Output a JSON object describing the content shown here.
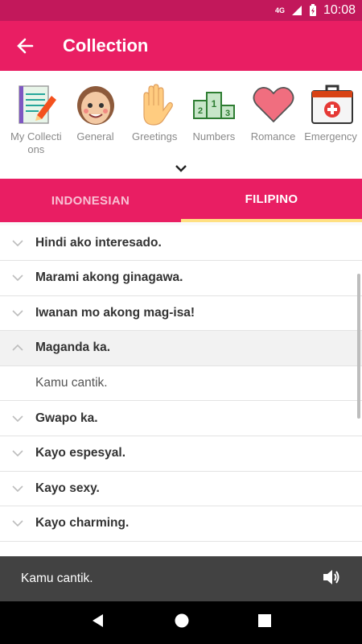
{
  "statusbar": {
    "network": "4G",
    "time": "10:08"
  },
  "appbar": {
    "title": "Collection"
  },
  "categories": [
    {
      "label": "My Collections",
      "icon": "notepad-pencil-icon"
    },
    {
      "label": "General",
      "icon": "face-icon"
    },
    {
      "label": "Greetings",
      "icon": "waving-hand-icon"
    },
    {
      "label": "Numbers",
      "icon": "podium-numbers-icon"
    },
    {
      "label": "Romance",
      "icon": "heart-icon"
    },
    {
      "label": "Emergency",
      "icon": "first-aid-kit-icon"
    }
  ],
  "tabs": [
    {
      "label": "INDONESIAN",
      "active": false
    },
    {
      "label": "FILIPINO",
      "active": true
    }
  ],
  "phrases": [
    {
      "text": "Hindi ako interesado."
    },
    {
      "text": "Marami akong ginagawa."
    },
    {
      "text": "Iwanan mo akong mag-isa!"
    },
    {
      "text": "Maganda ka.",
      "expanded": true,
      "translation": "Kamu cantik."
    },
    {
      "text": "Gwapo ka."
    },
    {
      "text": "Kayo espesyal."
    },
    {
      "text": "Kayo sexy."
    },
    {
      "text": "Kayo charming."
    }
  ],
  "player": {
    "text": "Kamu cantik."
  },
  "colors": {
    "primary": "#e91e63",
    "primary_dark": "#c2185b",
    "tab_indicator": "#ffe082"
  }
}
